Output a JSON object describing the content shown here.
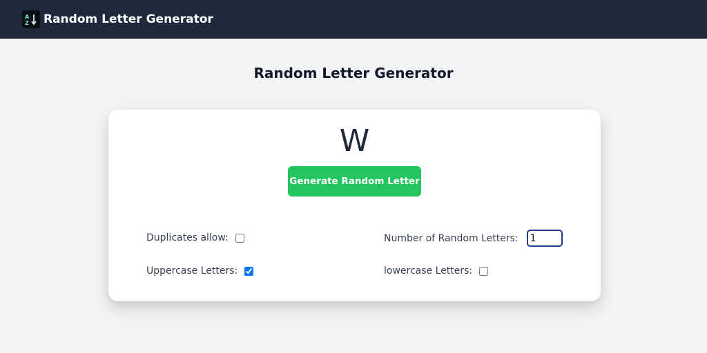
{
  "navbar": {
    "brand": "Random Letter Generator",
    "logo_icon": "sort-alpha-icon"
  },
  "main": {
    "title": "Random Letter Generator",
    "result_letter": "W",
    "generate_button": "Generate Random Letter"
  },
  "options": {
    "duplicates": {
      "label": "Duplicates allow:",
      "checked": false
    },
    "uppercase": {
      "label": "Uppercase Letters:",
      "checked": true
    },
    "number": {
      "label": "Number of Random Letters:",
      "value": "1"
    },
    "lowercase": {
      "label": "lowercase Letters:",
      "checked": false
    }
  },
  "colors": {
    "navbar": "#1e293b",
    "button": "#22c55e",
    "background": "#f3f4f6"
  }
}
